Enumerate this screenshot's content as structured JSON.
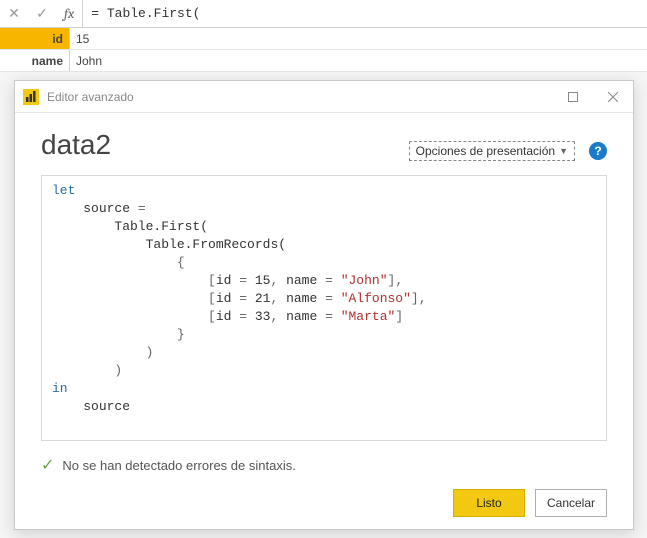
{
  "formula_bar": {
    "fx_label": "fx",
    "value": "= Table.First("
  },
  "grid": {
    "rows": [
      {
        "header": "id",
        "selected": true,
        "value": "15"
      },
      {
        "header": "name",
        "selected": false,
        "value": "John"
      }
    ]
  },
  "dialog": {
    "title": "Editor avanzado",
    "query_name": "data2",
    "display_options_label": "Opciones de presentación",
    "code_lines": [
      {
        "indent": 0,
        "tokens": [
          {
            "t": "let",
            "c": "kw"
          }
        ]
      },
      {
        "indent": 1,
        "tokens": [
          {
            "t": "source",
            "c": "ident"
          },
          {
            "t": " = ",
            "c": "punct"
          }
        ]
      },
      {
        "indent": 2,
        "tokens": [
          {
            "t": "Table.First(",
            "c": "ident"
          }
        ]
      },
      {
        "indent": 3,
        "tokens": [
          {
            "t": "Table.FromRecords(",
            "c": "ident"
          }
        ]
      },
      {
        "indent": 4,
        "tokens": [
          {
            "t": "{",
            "c": "punct"
          }
        ]
      },
      {
        "indent": 5,
        "tokens": [
          {
            "t": "[",
            "c": "punct"
          },
          {
            "t": "id",
            "c": "ident"
          },
          {
            "t": " = ",
            "c": "punct"
          },
          {
            "t": "15",
            "c": "num"
          },
          {
            "t": ", ",
            "c": "punct"
          },
          {
            "t": "name",
            "c": "ident"
          },
          {
            "t": " = ",
            "c": "punct"
          },
          {
            "t": "\"John\"",
            "c": "str"
          },
          {
            "t": "],",
            "c": "punct"
          }
        ]
      },
      {
        "indent": 5,
        "tokens": [
          {
            "t": "[",
            "c": "punct"
          },
          {
            "t": "id",
            "c": "ident"
          },
          {
            "t": " = ",
            "c": "punct"
          },
          {
            "t": "21",
            "c": "num"
          },
          {
            "t": ", ",
            "c": "punct"
          },
          {
            "t": "name",
            "c": "ident"
          },
          {
            "t": " = ",
            "c": "punct"
          },
          {
            "t": "\"Alfonso\"",
            "c": "str"
          },
          {
            "t": "],",
            "c": "punct"
          }
        ]
      },
      {
        "indent": 5,
        "tokens": [
          {
            "t": "[",
            "c": "punct"
          },
          {
            "t": "id",
            "c": "ident"
          },
          {
            "t": " = ",
            "c": "punct"
          },
          {
            "t": "33",
            "c": "num"
          },
          {
            "t": ", ",
            "c": "punct"
          },
          {
            "t": "name",
            "c": "ident"
          },
          {
            "t": " = ",
            "c": "punct"
          },
          {
            "t": "\"Marta\"",
            "c": "str"
          },
          {
            "t": "]",
            "c": "punct"
          }
        ]
      },
      {
        "indent": 4,
        "tokens": [
          {
            "t": "}",
            "c": "punct"
          }
        ]
      },
      {
        "indent": 3,
        "tokens": [
          {
            "t": ")",
            "c": "punct"
          }
        ]
      },
      {
        "indent": 2,
        "tokens": [
          {
            "t": ")",
            "c": "punct"
          }
        ]
      },
      {
        "indent": 0,
        "tokens": [
          {
            "t": "in",
            "c": "kw"
          }
        ]
      },
      {
        "indent": 1,
        "tokens": [
          {
            "t": "source",
            "c": "ident"
          }
        ]
      }
    ],
    "status_text": "No se han detectado errores de sintaxis.",
    "buttons": {
      "done": "Listo",
      "cancel": "Cancelar"
    }
  }
}
